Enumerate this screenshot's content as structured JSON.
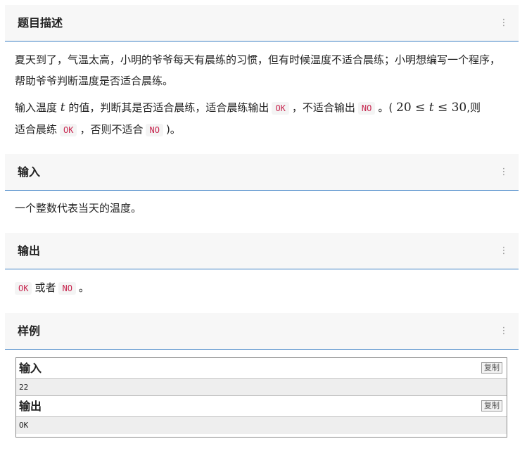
{
  "sections": {
    "description": {
      "title": "题目描述",
      "para1": "夏天到了，气温太高，小明的爷爷每天有晨练的习惯，但有时候温度不适合晨练；小明想编写一个程序，帮助爷爷判断温度是否适合晨练。",
      "para2": {
        "t1": "输入温度",
        "var_t": "t",
        "t2": "的值，判断其是否适合晨练，适合晨练输出",
        "code_ok": "OK",
        "t3": "，不适合输出",
        "code_no": "NO",
        "t4": "。(",
        "math_low": "20",
        "math_le1": "≤",
        "math_var": "t",
        "math_le2": "≤",
        "math_high": "30",
        "t5": ",则",
        "t6": "适合晨练",
        "code_ok2": "OK",
        "t7": "，否则不适合",
        "code_no2": "NO",
        "t8": ")。"
      }
    },
    "input": {
      "title": "输入",
      "text": "一个整数代表当天的温度。"
    },
    "output": {
      "title": "输出",
      "code_ok": "OK",
      "t1": "或者",
      "code_no": "NO",
      "t2": "。"
    },
    "sample": {
      "title": "样例",
      "input_label": "输入",
      "input_value": "22",
      "output_label": "输出",
      "output_value": "OK",
      "copy_label": "复制"
    }
  },
  "icons": {
    "kebab": "⋮"
  }
}
